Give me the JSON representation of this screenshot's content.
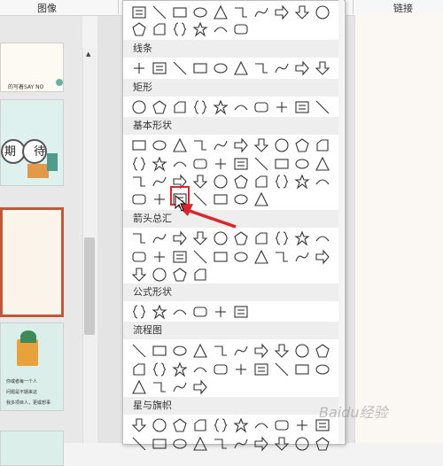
{
  "ribbon": {
    "left_label": "图像",
    "right_label": "链接"
  },
  "thumbnails": {
    "slide1_text": "的写着SAY NO",
    "slide2_text": "期 待",
    "slide4_text_line1": "你或者每一个人",
    "slide4_text_line2": "问题是不期来这",
    "slide4_text_line3": "我多项目人，更或想事"
  },
  "shape_menu": {
    "categories": [
      "线条",
      "矩形",
      "基本形状",
      "箭头总汇",
      "公式形状",
      "流程图",
      "星与旗帜"
    ],
    "highlighted_shape": "double-brace",
    "arrow_color": "#d9262c"
  },
  "watermark": "Baidu经验"
}
